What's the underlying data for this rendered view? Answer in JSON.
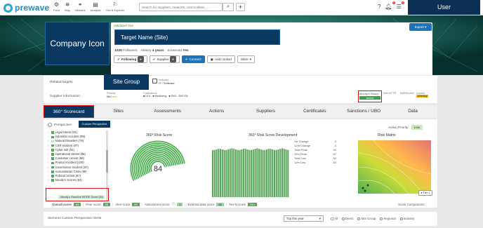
{
  "app": {
    "logo_text": "prewave"
  },
  "nav": [
    {
      "icon": "feed-icon",
      "glyph": "⚙",
      "label": "Feed"
    },
    {
      "icon": "map-icon",
      "glyph": "⛯",
      "label": "Map"
    },
    {
      "icon": "network-icon",
      "glyph": "⚭",
      "label": "Network"
    },
    {
      "icon": "analysis-icon",
      "glyph": "▤",
      "label": "Analysis"
    },
    {
      "icon": "tier-n-explorer-icon",
      "glyph": "⚐",
      "label": "Tier-N Explorer"
    }
  ],
  "search": {
    "placeholder": "Search for suppliers, seaports, commodities, ..."
  },
  "header_icons": {
    "notifications_badge": "9",
    "tasks_badge": "0"
  },
  "user": {
    "label": "User"
  },
  "hero": {
    "company_icon_label": "Company Icon",
    "validated_prefix": "Validated",
    "validated_suffix": "Site",
    "target_name": "Target Name (Site)",
    "followers_count": "1225",
    "followers_label": "Followers",
    "history_label": "History",
    "history_value": "4 years",
    "screened_label": "Screened",
    "screened_value": "Yes",
    "following_label": "Following",
    "supplier_label": "Supplier",
    "connect_label": "Connect",
    "add_contact_label": "Add contact",
    "more_label": "More",
    "export_label": "Export"
  },
  "info": {
    "related_targets_label": "Related targets",
    "supplier_information_label": "Supplier Information",
    "site_group_label": "Site Group",
    "industry_label": "Industry",
    "industry_value": "IT / Software",
    "priority_label": "Priority",
    "priority_value": "Mid",
    "collections_label": "Collections",
    "collections_values": [
      "LEG",
      "Monitoring",
      "SHS - SHS EN"
    ],
    "moodys_status_label": "Moody's Status",
    "moodys_status_value": "Active",
    "mtbf_label": "Net MTTR",
    "effective_label": "BitEffective",
    "impact_label": "Impact",
    "impact_value": "phishing"
  },
  "tabs": [
    "360° Scorecard",
    "Sites",
    "Assessments",
    "Actions",
    "Suppliers",
    "Certificates",
    "Sanctions / UBO",
    "Data"
  ],
  "perspective": {
    "label": "Perspective",
    "custom_label": "Custom Perspective",
    "action_priority_label": "Action Priority:",
    "action_priority_value": "Low"
  },
  "tree": [
    {
      "label": "Legal Stress (91)",
      "checked": true
    },
    {
      "label": "Industrial Accident (99)",
      "checked": true
    },
    {
      "label": "Natural Disasters (75)",
      "checked": false
    },
    {
      "label": "CSR Incident (97)",
      "checked": true
    },
    {
      "label": "Cyber risk (91)",
      "checked": true
    },
    {
      "label": "Operational Stress (98)",
      "checked": true
    },
    {
      "label": "Consumer Unrest (98)",
      "checked": true
    },
    {
      "label": "Product Incident (100)",
      "checked": true
    },
    {
      "label": "Governance Incident (97)",
      "checked": true
    },
    {
      "label": "Humanitarian Crisis (99)",
      "checked": true
    },
    {
      "label": "Political Unrest (87)",
      "checked": true
    },
    {
      "label": "Moody's Scores (84)",
      "checked": true
    }
  ],
  "tree_sub_item": "Moody's Reactive MORE Score (84)",
  "risk_score": {
    "title": "360° Risk Score",
    "value": "84"
  },
  "development": {
    "title": "360° Risk Score Development",
    "bar_values": [
      84,
      84,
      85,
      86,
      86,
      85,
      84,
      84,
      85,
      86,
      87,
      86,
      85,
      84,
      84,
      85,
      86,
      86,
      85,
      84,
      84,
      85,
      86,
      87,
      86,
      85,
      84,
      84,
      85,
      86,
      86,
      85,
      84,
      84,
      85,
      86,
      87,
      86,
      85,
      84
    ],
    "ylim": [
      0,
      100
    ],
    "stats": [
      {
        "label": "1st Change",
        "value": "0"
      },
      {
        "label": "12m Change",
        "value": "-3"
      },
      {
        "label": "Total Peak",
        "value": "90"
      },
      {
        "label": "12m Peak",
        "value": "87"
      },
      {
        "label": "Total Low",
        "value": "84"
      },
      {
        "label": "12m Low",
        "value": "84"
      }
    ]
  },
  "matrix": {
    "title": "Risk Matrix",
    "tier_button": "Tier 1"
  },
  "scores": {
    "overall_label": "Overall score",
    "overall_value": "84",
    "peer_label": "Peer score",
    "peer_value": "88",
    "alert_label": "Alert score",
    "alert_value": "88",
    "assessment_label": "Assessment score",
    "assessment_value": "0",
    "external_label": "External data score",
    "external_value": "65",
    "tier_n_label": "Tier-N score",
    "tier_n_value": "100",
    "components_label": "Score Components"
  },
  "alerts": {
    "title": "Siemens Custom Perspective Alerts",
    "period_value": "Top this year",
    "all_label": "All",
    "direct_label": "Direct",
    "site_group_label": "Site Group",
    "regional_label": "Regional",
    "industry_label": "Industry"
  }
}
